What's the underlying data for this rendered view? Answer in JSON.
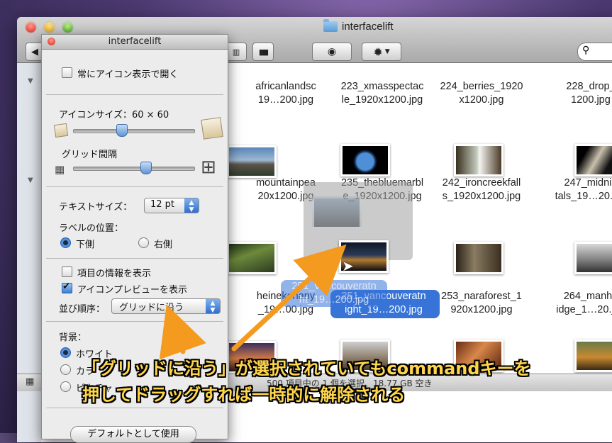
{
  "finder": {
    "title": "interfacelift",
    "status": "500 項目中の 1 個を選択、18.77 GB 空き",
    "toolbar": {
      "view_columns_icon": "columns-icon",
      "view_coverflow_icon": "coverflow-icon",
      "quicklook_icon": "eye-icon",
      "action_icon": "gear-icon"
    }
  },
  "items_row1": [
    "africanlandsc\n19…200.jpg",
    "223_xmasspectac\nle_1920x1200.jpg",
    "224_berries_1920\nx1200.jpg",
    "228_drop_\n1200.jpg"
  ],
  "items_row2": [
    "mountainpea\n20x1200.jpg",
    "235_thebluemarbl\ne_1920x1200.jpg",
    "242_ironcreekfall\ns_1920x1200.jpg",
    "247_midnig\ntals_19…20.jpg"
  ],
  "items_row3": [
    "heinekenany\n_19…00.jpg",
    "251_vancouveratn\night_19…200.jpg",
    "253_naraforest_1\n920x1200.jpg",
    "264_manha\nidge_1…20.jpg"
  ],
  "drag_ghost_label": "251_vancouveratn\nht_19…200.jpg",
  "panel": {
    "title": "interfacelift",
    "open_always_icon": "常にアイコン表示で開く",
    "icon_size_label": "アイコンサイズ：60 × 60",
    "grid_spacing_label": "グリッド間隔",
    "text_size_label": "テキストサイズ：",
    "text_size_value": "12 pt",
    "label_position_label": "ラベルの位置：",
    "label_bottom": "下側",
    "label_right": "右側",
    "show_item_info": "項目の情報を表示",
    "show_icon_preview": "アイコンプレビューを表示",
    "sort_by_label": "並び順序：",
    "sort_by_value": "グリッドに沿う",
    "background_label": "背景：",
    "bg_white": "ホワイト",
    "bg_color": "カラ",
    "bg_picture": "ピクチャ",
    "use_as_default": "デフォルトとして使用",
    "icon_size_level": 0.4,
    "grid_spacing_level": 0.6
  },
  "annotation": {
    "line1": "「グリッドに沿う」が選択されていてもcommandキーを",
    "line2": "押してドラッグすれば一時的に解除される"
  },
  "colors": {
    "annotation_text": "#ffd64a",
    "arrow": "#f39a1f",
    "selection": "#3874d8"
  }
}
